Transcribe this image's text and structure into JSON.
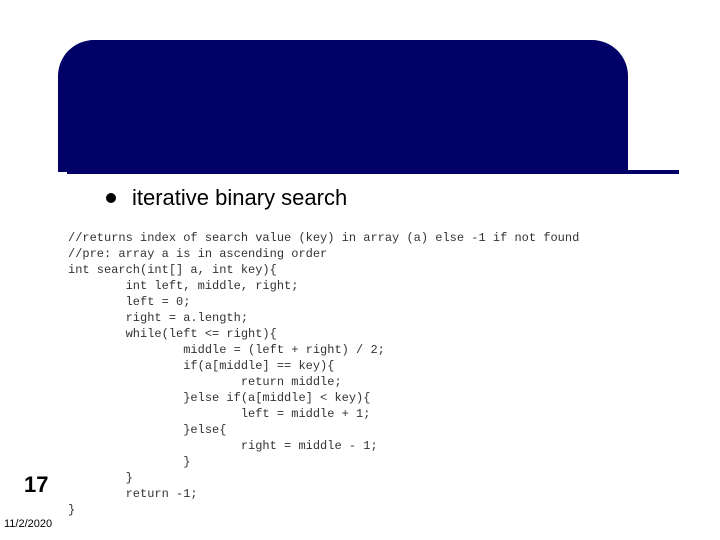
{
  "header": {
    "title": ""
  },
  "bullet": {
    "text": "iterative binary search"
  },
  "code": "//returns index of search value (key) in array (a) else -1 if not found\n//pre: array a is in ascending order\nint search(int[] a, int key){\n        int left, middle, right;\n        left = 0;\n        right = a.length;\n        while(left <= right){\n                middle = (left + right) / 2;\n                if(a[middle] == key){\n                        return middle;\n                }else if(a[middle] < key){\n                        left = middle + 1;\n                }else{\n                        right = middle - 1;\n                }\n        }\n        return -1;\n}",
  "footer": {
    "page": "17",
    "date": "11/2/2020"
  }
}
